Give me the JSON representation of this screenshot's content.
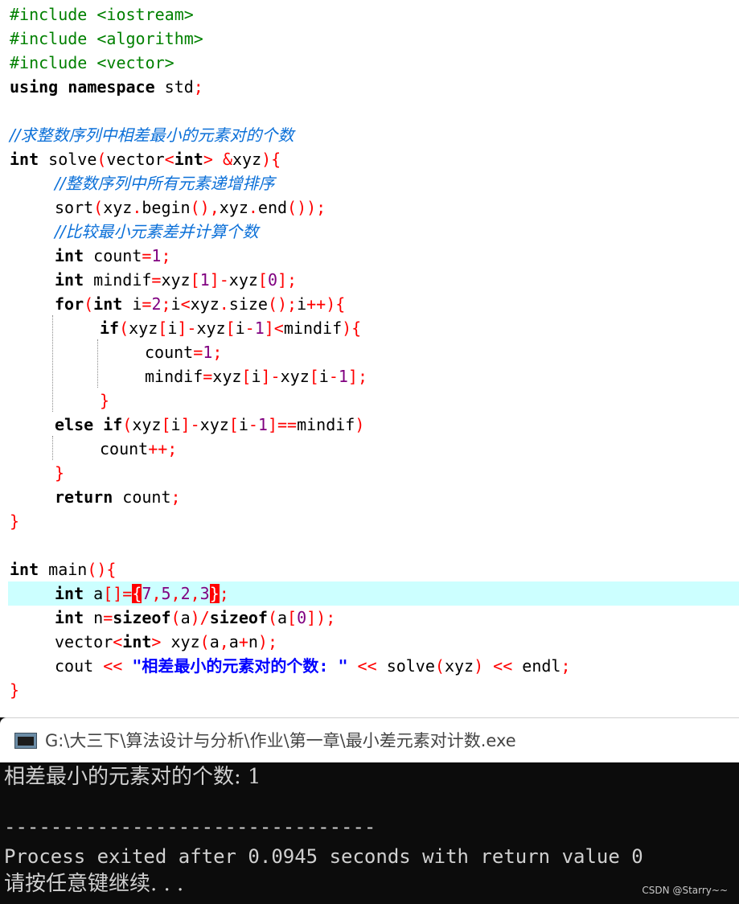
{
  "editor": {
    "lines": {
      "l01": {
        "t1": "#include <iostream>"
      },
      "l02": {
        "t1": "#include <algorithm>"
      },
      "l03": {
        "t1": "#include <vector>"
      },
      "l04": {
        "t1": "using namespace",
        "t2": " std",
        "t3": ";"
      },
      "l06": {
        "t1": "//求整数序列中相差最小的元素对的个数"
      },
      "l07": {
        "t1": "int",
        "t2": " solve",
        "t3": "(",
        "t4": "vector",
        "t5": "<",
        "t6": "int",
        "t7": ">",
        "t8": " ",
        "t9": "&",
        "t10": "xyz",
        "t11": "){"
      },
      "l08": {
        "t1": "//整数序列中所有元素递增排序"
      },
      "l09": {
        "t1": "sort",
        "t2": "(",
        "t3": "xyz",
        "t4": ".",
        "t5": "begin",
        "t6": "(),",
        "t7": "xyz",
        "t8": ".",
        "t9": "end",
        "t10": "());"
      },
      "l10": {
        "t1": "//比较最小元素差并计算个数"
      },
      "l11": {
        "t1": "int",
        "t2": " count",
        "t3": "=",
        "t4": "1",
        "t5": ";"
      },
      "l12": {
        "t1": "int",
        "t2": " mindif",
        "t3": "=",
        "t4": "xyz",
        "t5": "[",
        "t6": "1",
        "t7": "]-",
        "t8": "xyz",
        "t9": "[",
        "t10": "0",
        "t11": "];"
      },
      "l13": {
        "t1": "for",
        "t2": "(",
        "t3": "int",
        "t4": " i",
        "t5": "=",
        "t6": "2",
        "t7": ";",
        "t8": "i",
        "t9": "<",
        "t10": "xyz",
        "t11": ".",
        "t12": "size",
        "t13": "();",
        "t14": "i",
        "t15": "++){"
      },
      "l14": {
        "t1": "if",
        "t2": "(",
        "t3": "xyz",
        "t4": "[",
        "t5": "i",
        "t6": "]-",
        "t7": "xyz",
        "t8": "[",
        "t9": "i",
        "t10": "-",
        "t11": "1",
        "t12": "]<",
        "t13": "mindif",
        "t14": "){"
      },
      "l15": {
        "t1": "count",
        "t2": "=",
        "t3": "1",
        "t4": ";"
      },
      "l16": {
        "t1": "mindif",
        "t2": "=",
        "t3": "xyz",
        "t4": "[",
        "t5": "i",
        "t6": "]-",
        "t7": "xyz",
        "t8": "[",
        "t9": "i",
        "t10": "-",
        "t11": "1",
        "t12": "];"
      },
      "l17": {
        "t1": "}"
      },
      "l18": {
        "t1": "else if",
        "t2": "(",
        "t3": "xyz",
        "t4": "[",
        "t5": "i",
        "t6": "]-",
        "t7": "xyz",
        "t8": "[",
        "t9": "i",
        "t10": "-",
        "t11": "1",
        "t12": "]==",
        "t13": "mindif",
        "t14": ")"
      },
      "l19": {
        "t1": "count",
        "t2": "++;"
      },
      "l20": {
        "t1": "}"
      },
      "l21": {
        "t1": "return",
        "t2": " count",
        "t3": ";"
      },
      "l22": {
        "t1": "}"
      },
      "l24": {
        "t1": "int",
        "t2": " main",
        "t3": "(){"
      },
      "l25": {
        "t1": "int",
        "t2": " a",
        "t3": "[]=",
        "t4": "{",
        "t5": "7",
        "t6": ",",
        "t7": "5",
        "t8": ",",
        "t9": "2",
        "t10": ",",
        "t11": "3",
        "t12": "}",
        "t13": ";"
      },
      "l26": {
        "t1": "int",
        "t2": " n",
        "t3": "=",
        "t4": "sizeof",
        "t5": "(",
        "t6": "a",
        "t7": ")/",
        "t8": "sizeof",
        "t9": "(",
        "t10": "a",
        "t11": "[",
        "t12": "0",
        "t13": "]);"
      },
      "l27": {
        "t1": "vector",
        "t2": "<",
        "t3": "int",
        "t4": ">",
        "t5": " xyz",
        "t6": "(",
        "t7": "a",
        "t8": ",",
        "t9": "a",
        "t10": "+",
        "t11": "n",
        "t12": ");"
      },
      "l28": {
        "t1": "cout",
        "t2": " << ",
        "t3": "\"相差最小的元素对的个数: \"",
        "t4": " << ",
        "t5": "solve",
        "t6": "(",
        "t7": "xyz",
        "t8": ")",
        "t9": " << ",
        "t10": "endl",
        "t11": ";"
      },
      "l29": {
        "t1": "}"
      }
    }
  },
  "console": {
    "title": "G:\\大三下\\算法设计与分析\\作业\\第一章\\最小差元素对计数.exe",
    "output_line1": "相差最小的元素对的个数: 1",
    "separator": "--------------------------------",
    "exit_line": "Process exited after 0.0945 seconds with return value 0",
    "prompt_line": "请按任意键继续. . ."
  },
  "watermark": "CSDN @Starry~~",
  "icons": {
    "console": "console-window-icon"
  },
  "colors": {
    "keyword": "#000000",
    "preprocessor": "#008000",
    "comment": "#0a6fd8",
    "symbol": "#ff0000",
    "number": "#800080",
    "string": "#0000ff",
    "current_line": "#ccffff",
    "console_bg": "#0c0c0c"
  }
}
